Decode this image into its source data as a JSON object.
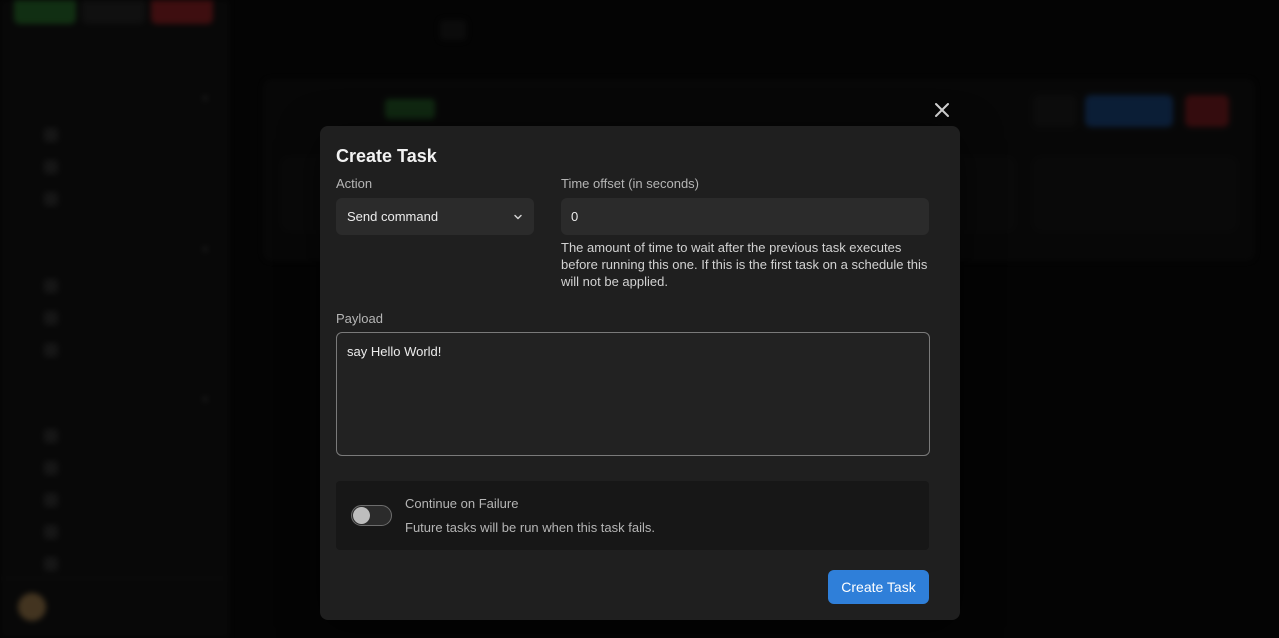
{
  "modal": {
    "title": "Create Task",
    "close_icon": "close-icon",
    "action": {
      "label": "Action",
      "value": "Send command",
      "icon": "chevron-down-icon"
    },
    "time_offset": {
      "label": "Time offset (in seconds)",
      "value": "0",
      "help": "The amount of time to wait after the previous task executes before running this one. If this is the first task on a schedule this will not be applied."
    },
    "payload": {
      "label": "Payload",
      "value": "say Hello World!"
    },
    "continue_on_failure": {
      "title": "Continue on Failure",
      "description": "Future tasks will be run when this task fails.",
      "enabled": false
    },
    "submit_label": "Create Task",
    "accent_color": "#2f7fd9"
  }
}
